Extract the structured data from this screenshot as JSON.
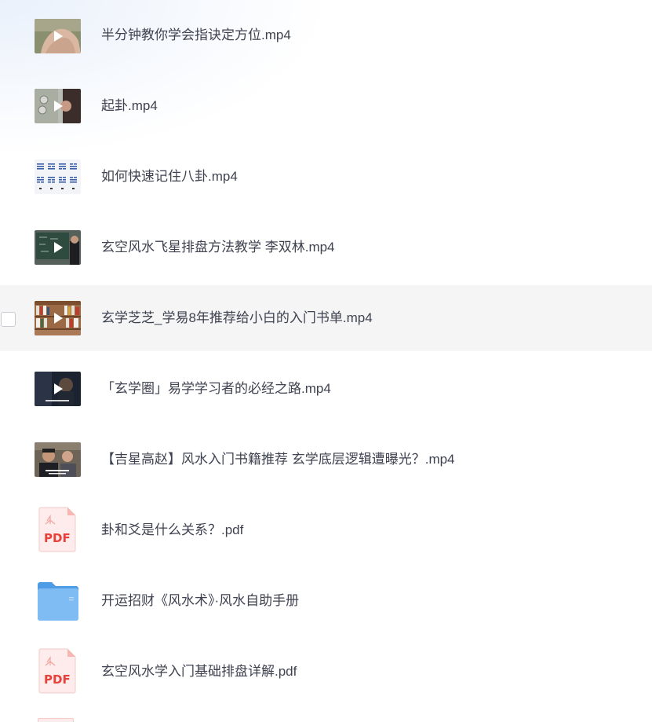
{
  "files": [
    {
      "name": "半分钟教你学会指诀定方位.mp4",
      "type": "video",
      "thumb_icon": "hand-video-thumbnail"
    },
    {
      "name": "起卦.mp4",
      "type": "video",
      "thumb_icon": "coins-video-thumbnail"
    },
    {
      "name": "如何快速记住八卦.mp4",
      "type": "video",
      "thumb_icon": "trigrams-chart-thumbnail"
    },
    {
      "name": "玄空风水飞星排盘方法教学 李双林.mp4",
      "type": "video",
      "thumb_icon": "blackboard-teacher-thumbnail"
    },
    {
      "name": "玄学芝芝_学易8年推荐给小白的入门书单.mp4",
      "type": "video",
      "thumb_icon": "bookshelf-video-thumbnail"
    },
    {
      "name": "「玄学圈」易学学习者的必经之路.mp4",
      "type": "video",
      "thumb_icon": "dark-portrait-video-thumbnail"
    },
    {
      "name": "【吉星高赵】风水入门书籍推荐 玄学底层逻辑遭曝光？.mp4",
      "type": "video",
      "thumb_icon": "two-people-video-thumbnail"
    },
    {
      "name": "卦和爻是什么关系？.pdf",
      "type": "pdf",
      "thumb_icon": "pdf-file-icon"
    },
    {
      "name": "开运招财《风水术》·风水自助手册",
      "type": "folder",
      "thumb_icon": "folder-icon"
    },
    {
      "name": "玄空风水学入门基础排盘详解.pdf",
      "type": "pdf",
      "thumb_icon": "pdf-file-icon"
    }
  ],
  "pdf_label": "PDF",
  "colors": {
    "text": "#3f4250",
    "hover_row": "#f5f5f6",
    "pdf_red": "#e8403a",
    "folder_blue": "#5aa6ec"
  }
}
